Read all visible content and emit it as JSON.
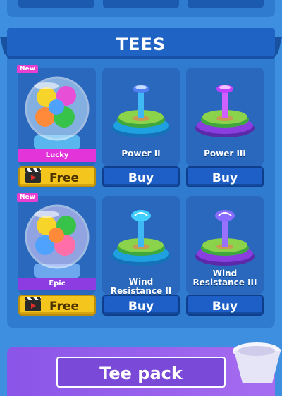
{
  "section": {
    "title": "TEES"
  },
  "pack": {
    "label": "Tee pack"
  },
  "items": [
    {
      "name": "Lucky",
      "badge": "New",
      "button": "Free",
      "kind": "gacha",
      "color": "#e234d8"
    },
    {
      "name": "Power II",
      "button": "Buy",
      "kind": "tee",
      "base": "#1fa0e0",
      "top": "#4fb0ff"
    },
    {
      "name": "Power III",
      "button": "Buy",
      "kind": "tee",
      "base": "#8a3ee0",
      "top": "#c040ff"
    },
    {
      "name": "Epic",
      "badge": "New",
      "button": "Free",
      "kind": "gacha",
      "color": "#8c3ce0"
    },
    {
      "name": "Wind Resistance II",
      "button": "Buy",
      "kind": "tee",
      "base": "#1fa0e0",
      "top": "#3fd0ff"
    },
    {
      "name": "Wind Resistance III",
      "button": "Buy",
      "kind": "tee",
      "base": "#8a3ee0",
      "top": "#8a6bff"
    }
  ]
}
